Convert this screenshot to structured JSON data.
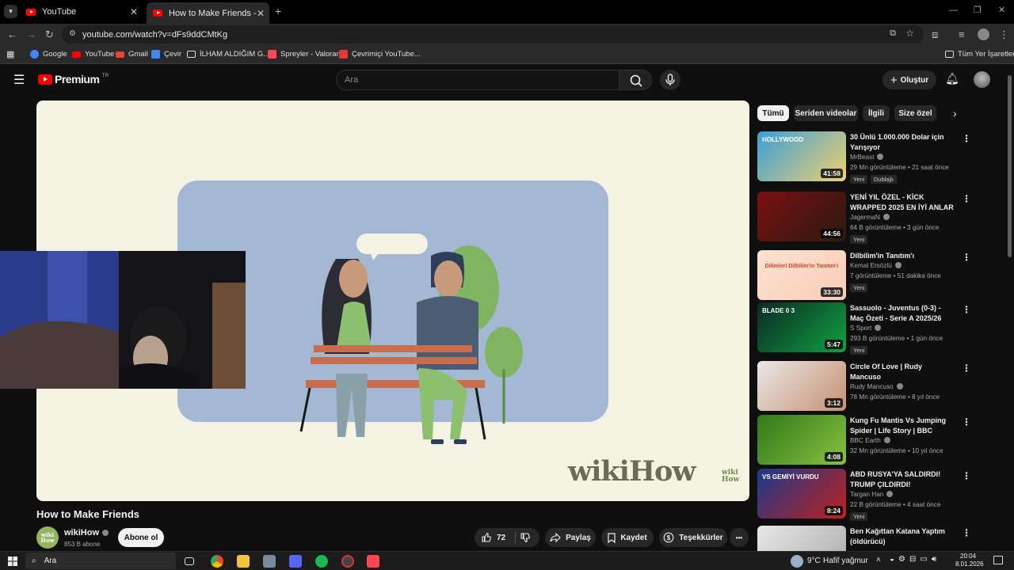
{
  "browser": {
    "tabs": [
      {
        "title": "YouTube",
        "active": false
      },
      {
        "title": "How to Make Friends - YouTube",
        "active": true
      }
    ],
    "new_tab": "+",
    "url": "youtube.com/watch?v=dFs9ddCMtKg",
    "bookmarks": [
      {
        "label": "Google",
        "icon": "google-icon",
        "color": "#4285f4"
      },
      {
        "label": "YouTube",
        "icon": "youtube-icon",
        "color": "#ff0000"
      },
      {
        "label": "Gmail",
        "icon": "gmail-icon",
        "color": "#ea4335"
      },
      {
        "label": "Çevir",
        "icon": "translate-icon",
        "color": "#4285f4"
      },
      {
        "label": "İLHAM ALDIĞIM G...",
        "icon": "folder-icon",
        "color": "#dddddd"
      },
      {
        "label": "Spreyler - Valorant",
        "icon": "valorant-icon",
        "color": "#ff4655"
      },
      {
        "label": "Çevrimiçi YouTube...",
        "icon": "download-icon",
        "color": "#e53935"
      }
    ],
    "all_bookmarks": "Tüm Yer İşaretleri"
  },
  "youtube": {
    "logo": "Premium",
    "region": "TR",
    "search_placeholder": "Ara",
    "create_label": "Oluştur"
  },
  "video": {
    "title": "How to Make Friends",
    "watermark": "wikiHow",
    "watermark_small_top": "wiki",
    "watermark_small_bottom": "How",
    "channel": "wikiHow",
    "channel_avatar_top": "wiki",
    "channel_avatar_bottom": "How",
    "subscribers": "853 B abone",
    "subscribe_label": "Abone ol",
    "likes": "72",
    "share_label": "Paylaş",
    "save_label": "Kaydet",
    "thanks_label": "Teşekkürler",
    "more_label": "•••"
  },
  "sidebar": {
    "chips": [
      "Tümü",
      "Seriden videolar",
      "İlgili",
      "Size özel"
    ],
    "recommendations": [
      {
        "title": "30 Ünlü 1.000.000 Dolar için Yarışıyor",
        "channel": "MrBeast",
        "meta": "29 Mn görüntüleme • 21 saat önce",
        "badges": [
          "Yeni",
          "Dublajlı"
        ],
        "duration": "41:58",
        "thumb_text": "HOLLYWOOD",
        "colors": [
          "#3aa0d8",
          "#f0d070"
        ]
      },
      {
        "title": "YENİ YIL ÖZEL - KİCK WRAPPED 2025 EN İYİ ANLAR",
        "channel": "JagermaN",
        "meta": "64 B görüntüleme • 3 gün önce",
        "badges": [
          "Yeni"
        ],
        "duration": "44:56",
        "thumb_text": "",
        "colors": [
          "#7a1010",
          "#2a1a10"
        ]
      },
      {
        "title": "Dilbilim'in Tanıtım'ı",
        "channel": "Kemal Ersözlü",
        "meta": "7 görüntüleme • 51 dakika önce",
        "badges": [
          "Yeni"
        ],
        "duration": "33:30",
        "thumb_text": "Dilimleri Dilbilim'in Tanıtım'ı",
        "colors": [
          "#fde1d0",
          "#f7cdb8"
        ]
      },
      {
        "title": "Sassuolo - Juventus (0-3) - Maç Özeti - Serie A 2025/26",
        "channel": "S Sport",
        "meta": "293 B görüntüleme • 1 gün önce",
        "badges": [
          "Yeni"
        ],
        "duration": "5:47",
        "thumb_text": "BLADE 0 3",
        "colors": [
          "#0a2a24",
          "#10a040"
        ]
      },
      {
        "title": "Circle Of Love | Rudy Mancuso",
        "channel": "Rudy Mancuso",
        "meta": "78 Mn görüntüleme • 8 yıl önce",
        "badges": [],
        "duration": "3:12",
        "thumb_text": "",
        "colors": [
          "#e8e8e8",
          "#c89070"
        ]
      },
      {
        "title": "Kung Fu Mantis Vs Jumping Spider | Life Story | BBC",
        "channel": "BBC Earth",
        "meta": "32 Mn görüntüleme • 10 yıl önce",
        "badges": [],
        "duration": "4:08",
        "thumb_text": "",
        "colors": [
          "#2f7a1a",
          "#8ac040"
        ]
      },
      {
        "title": "ABD RUSYA'YA SALDIRDI! TRUMP ÇILDIRDI!",
        "channel": "Targan Han",
        "meta": "22 B görüntüleme • 4 saat önce",
        "badges": [
          "Yeni"
        ],
        "duration": "8:24",
        "thumb_text": "VS GEMİYİ VURDU",
        "colors": [
          "#1a3a8a",
          "#c02020"
        ]
      },
      {
        "title": "Ben Kağıttan Katana Yaptım (öldürücü)",
        "channel": "",
        "meta": "",
        "badges": [],
        "duration": "",
        "thumb_text": "",
        "colors": [
          "#e8e8e8",
          "#aaaaaa"
        ]
      }
    ]
  },
  "taskbar": {
    "search_placeholder": "Ara",
    "weather_temp": "9°C",
    "weather_text": "Hafif yağmur",
    "time": "20:04",
    "date": "8.01.2026"
  }
}
